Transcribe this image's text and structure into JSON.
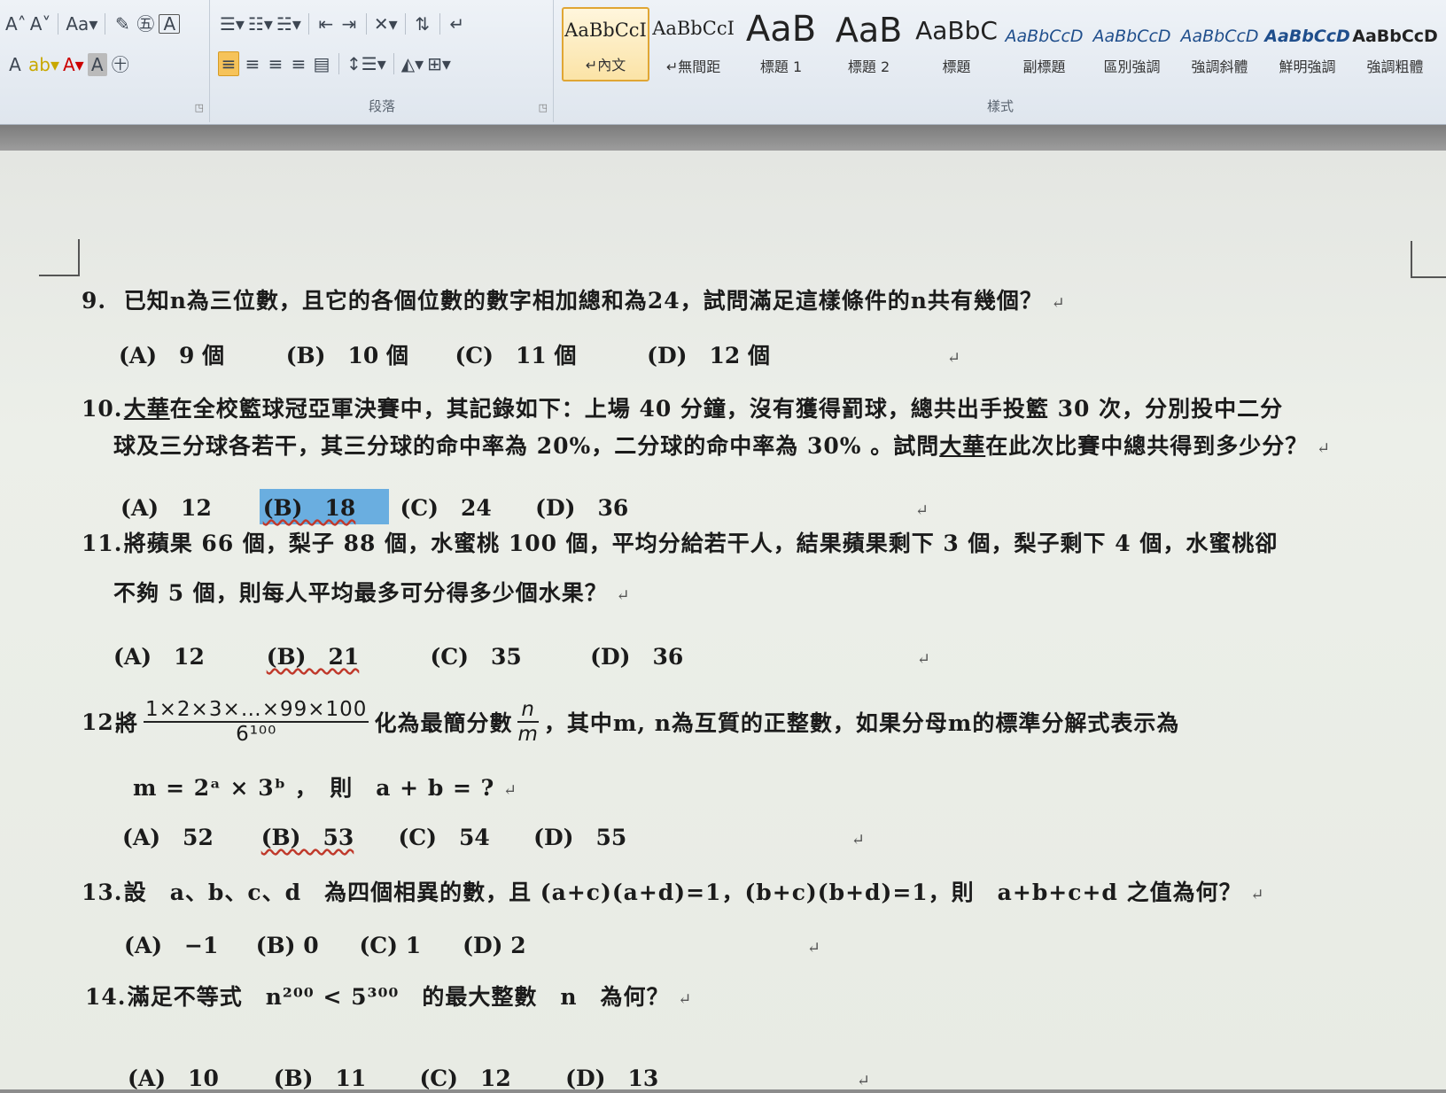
{
  "ribbon": {
    "paragraph_label": "段落",
    "styles_label": "樣式",
    "styles": [
      {
        "sample": "AaBbCcI",
        "name": "↵內文"
      },
      {
        "sample": "AaBbCcI",
        "name": "↵無間距"
      },
      {
        "sample": "AaB",
        "name": "標題 1"
      },
      {
        "sample": "AaB",
        "name": "標題 2"
      },
      {
        "sample": "AaBbC",
        "name": "標題"
      },
      {
        "sample": "AaBbCcD",
        "name": "副標題"
      },
      {
        "sample": "AaBbCcD",
        "name": "區別強調"
      },
      {
        "sample": "AaBbCcD",
        "name": "強調斜體"
      },
      {
        "sample": "AaBbCcD",
        "name": "鮮明強調"
      },
      {
        "sample": "AaBbCcD",
        "name": "強調粗體"
      }
    ]
  },
  "questions": {
    "q9": {
      "num": "9.",
      "text": "已知n為三位數，且它的各個位數的數字相加總和為24，試問滿足這樣條件的n共有幾個？",
      "options": [
        "(A)　9 個",
        "(B)　10 個",
        "(C)　11 個",
        "(D)　12 個"
      ]
    },
    "q10": {
      "num": "10.",
      "name": "大華",
      "line1": "在全校籃球冠亞軍決賽中，其記錄如下：上場 40 分鐘，沒有獲得罰球，總共出手投籃 30 次，分別投中二分",
      "line2a": "球及三分球各若干，其三分球的命中率為 20%，二分球的命中率為 30% 。試問",
      "line2b": "在此次比賽中總共得到多少分？",
      "options": [
        "(A)　12",
        "(B)　18",
        "(C)　24",
        "(D)　36"
      ]
    },
    "q11": {
      "num": "11.",
      "line1": "將蘋果 66 個，梨子 88 個，水蜜桃 100 個，平均分給若干人，結果蘋果剩下 3 個，梨子剩下 4 個，水蜜桃卻",
      "line2": "不夠 5 個，則每人平均最多可分得多少個水果？",
      "options": [
        "(A)　12",
        "(B)　21",
        "(C)　35",
        "(D)　36"
      ]
    },
    "q12": {
      "num": "12.",
      "pre": "將",
      "frac_num": "1×2×3×…×99×100",
      "frac_den": "6¹⁰⁰",
      "mid": "化為最簡分數",
      "frac2_num": "n",
      "frac2_den": "m",
      "post": "，其中m, n為互質的正整數，如果分母m的標準分解式表示為",
      "line2": "m = 2ᵃ × 3ᵇ ，　則　a + b = ?",
      "options": [
        "(A)　52",
        "(B)　53",
        "(C)　54",
        "(D)　55"
      ]
    },
    "q13": {
      "num": "13.",
      "text": "設　a、b、c、d　為四個相異的數，且 (a+c)(a+d)=1，(b+c)(b+d)=1，則　a+b+c+d 之值為何？",
      "options": [
        "(A)　−1",
        "(B) 0",
        "(C) 1",
        "(D) 2"
      ]
    },
    "q14": {
      "num": "14.",
      "text": "滿足不等式　n²⁰⁰ < 5³⁰⁰　的最大整數　n　為何？",
      "options": [
        "(A)　10",
        "(B)　11",
        "(C)　12",
        "(D)　13"
      ]
    }
  }
}
